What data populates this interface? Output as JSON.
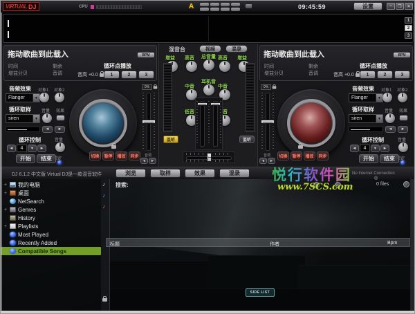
{
  "titlebar": {
    "logo_main": "VIRTUAL",
    "logo_dj": "DJ",
    "cpu_label": "CPU",
    "warning": "A",
    "clock": "09:45:59",
    "settings": "设置",
    "btn_min": "–",
    "btn_max": "❒",
    "btn_close": "✕"
  },
  "waveform": {
    "slot1": "1",
    "slot2": "2",
    "slot3": "3"
  },
  "deck_left": {
    "drop_label": "拖动歌曲到此载入",
    "time_label": "时间",
    "remain_label": "剩余",
    "gain_label": "增益分贝",
    "pitch_label": "音调",
    "pitch_readout": "音高 +0.0",
    "bpm_button": "BPM",
    "loop_play_label": "循环点播放",
    "cue1": "1",
    "cue2": "2",
    "cue3": "3",
    "fx_title": "音频效果",
    "fx_param1": "对象1",
    "fx_param2": "对象2",
    "fx_selected": "Flanger",
    "sample_title": "循环取样",
    "sample_vol": "音量",
    "sample_fx": "效果",
    "sample_selected": "siren",
    "loop_title": "循环控制",
    "loop_len": "4",
    "loop_vol": "音量",
    "lock_label": "锁定",
    "loop_in": "开始",
    "loop_out": "结束",
    "t1": "切换",
    "t2": "暂停",
    "t3": "播放",
    "t4": "同步",
    "pitch_pct": "0%",
    "bend_label": "音调",
    "arrow_left": "◄",
    "arrow_right": "►",
    "arrow_down": "▼"
  },
  "deck_right": {
    "drop_label": "拖动歌曲到此载入",
    "time_label": "时间",
    "remain_label": "剩余",
    "gain_label": "增益分贝",
    "pitch_label": "音调",
    "pitch_readout": "音高 +0.0",
    "bpm_button": "BPM",
    "loop_play_label": "循环点播放",
    "cue1": "1",
    "cue2": "2",
    "cue3": "3",
    "fx_title": "音频效果",
    "fx_param1": "对象1",
    "fx_param2": "对象2",
    "fx_selected": "Flanger",
    "sample_title": "循环取样",
    "sample_vol": "音量",
    "sample_fx": "效果",
    "sample_selected": "siren",
    "loop_title": "循环控制",
    "loop_len": "4",
    "loop_vol": "音量",
    "lock_label": "锁定",
    "loop_in": "开始",
    "loop_out": "结束",
    "t1": "切换",
    "t2": "暂停",
    "t3": "播放",
    "t4": "同步",
    "pitch_pct": "0%",
    "bend_label": "音调",
    "arrow_left": "◄",
    "arrow_right": "►",
    "arrow_down": "▼"
  },
  "mixer": {
    "tab_mixer": "混音台",
    "tab_video": "视频",
    "tab_record": "混录",
    "gain": "增益",
    "high": "高音",
    "mid": "中音",
    "low": "低音",
    "master": "总音量",
    "phones": "耳机音",
    "pfl": "监听"
  },
  "toolbar": {
    "version": "DJ 6.1.2 中文版  Virtual DJ是一款混音软件",
    "tab_browse": "浏览",
    "tab_sampler": "取样",
    "tab_effects": "效果",
    "tab_record": "混录",
    "connection": "No Internet Connection"
  },
  "browser": {
    "search_label": "搜索:",
    "files_count": "0 files",
    "col_title": "标题",
    "col_artist": "作者",
    "col_bpm": "Bpm",
    "sidelist": "SIDE LIST",
    "sidebar": [
      {
        "label": "我的电脑",
        "icon": "computer-icon",
        "expand": "+"
      },
      {
        "label": "桌面",
        "icon": "desktop-icon",
        "expand": "+"
      },
      {
        "label": "NetSearch",
        "icon": "globe-icon",
        "expand": ""
      },
      {
        "label": "Genres",
        "icon": "genres-icon",
        "expand": "+"
      },
      {
        "label": "History",
        "icon": "history-icon",
        "expand": ""
      },
      {
        "label": "Playlists",
        "icon": "playlists-icon",
        "expand": "+"
      },
      {
        "label": "Most Played",
        "icon": "autoplaylist-icon",
        "expand": ""
      },
      {
        "label": "Recently Added",
        "icon": "autoplaylist-icon",
        "expand": ""
      },
      {
        "label": "Compatible Songs",
        "icon": "autoplaylist-icon",
        "expand": ""
      }
    ]
  },
  "watermark": {
    "title": "悦行软件园",
    "url": "www.7SCS.com",
    "reg": "®"
  }
}
